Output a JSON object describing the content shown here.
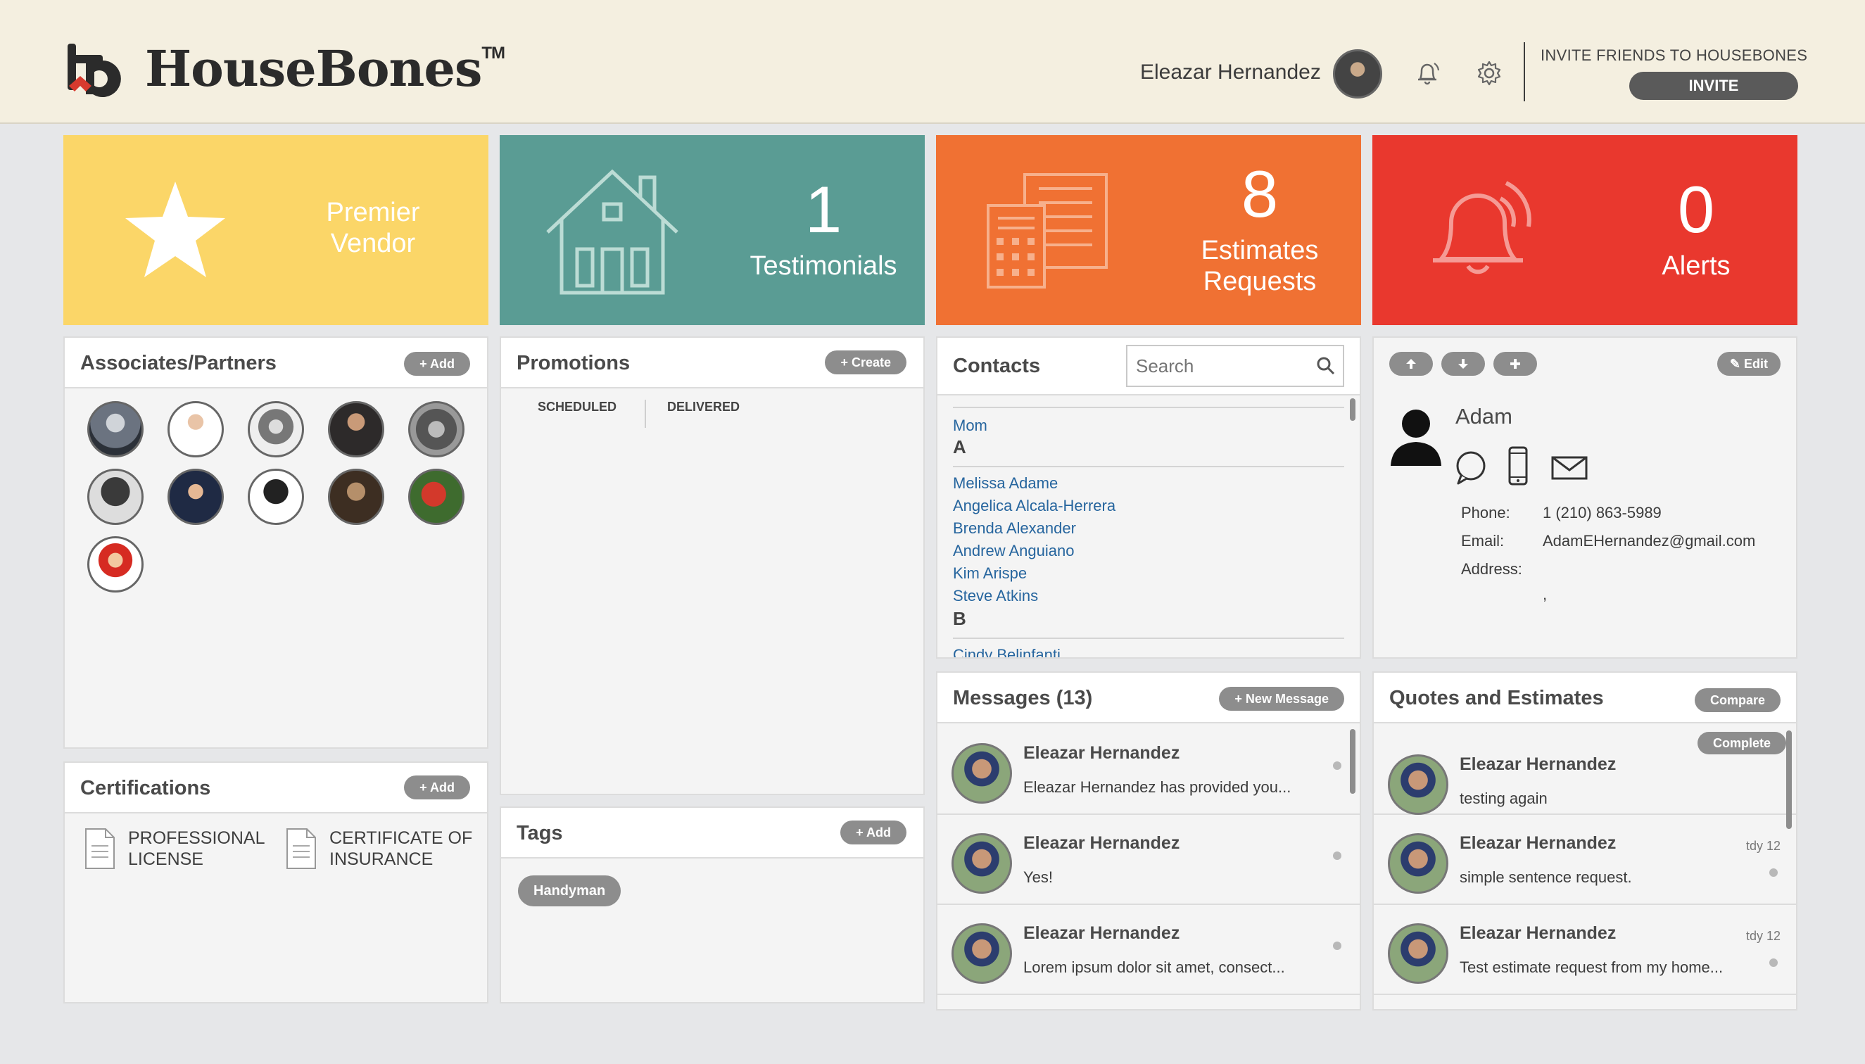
{
  "header": {
    "brand": "HouseBones",
    "brand_tm": "TM",
    "user_name": "Eleazar Hernandez",
    "invite_prompt": "INVITE FRIENDS TO HOUSEBONES",
    "invite_label": "INVITE"
  },
  "tiles": {
    "premier": {
      "label_line1": "Premier",
      "label_line2": "Vendor"
    },
    "testimonials": {
      "count": "1",
      "label": "Testimonials"
    },
    "estimates": {
      "count": "8",
      "label_line1": "Estimates",
      "label_line2": "Requests"
    },
    "alerts": {
      "count": "0",
      "label": "Alerts"
    }
  },
  "associates": {
    "title": "Associates/Partners",
    "add_label": "+ Add"
  },
  "certifications": {
    "title": "Certifications",
    "add_label": "+ Add",
    "items": [
      {
        "line1": "PROFESSIONAL",
        "line2": "LICENSE"
      },
      {
        "line1": "CERTIFICATE OF",
        "line2": "INSURANCE"
      }
    ]
  },
  "promotions": {
    "title": "Promotions",
    "create_label": "+ Create",
    "tab_scheduled": "SCHEDULED",
    "tab_delivered": "DELIVERED"
  },
  "tags": {
    "title": "Tags",
    "add_label": "+ Add",
    "items": [
      "Handyman"
    ]
  },
  "contacts": {
    "title": "Contacts",
    "search_placeholder": "Search",
    "top_link": "Mom",
    "group_a": "A",
    "a_items": [
      "Melissa Adame",
      "Angelica Alcala-Herrera",
      "Brenda Alexander",
      "Andrew Anguiano",
      "Kim Arispe",
      "Steve Atkins"
    ],
    "group_b": "B",
    "b_items": [
      "Cindy Belinfanti"
    ]
  },
  "contact_detail": {
    "edit_label": "✎ Edit",
    "name": "Adam",
    "phone_label": "Phone:",
    "phone": "1 (210) 863-5989",
    "email_label": "Email:",
    "email": "AdamEHernandez@gmail.com",
    "address_label": "Address:",
    "address": ","
  },
  "messages": {
    "title": "Messages (13)",
    "new_label": "+ New Message",
    "items": [
      {
        "name": "Eleazar Hernandez",
        "text": "Eleazar Hernandez has provided you..."
      },
      {
        "name": "Eleazar Hernandez",
        "text": "Yes!"
      },
      {
        "name": "Eleazar Hernandez",
        "text": "Lorem ipsum dolor sit amet, consect..."
      }
    ]
  },
  "quotes": {
    "title": "Quotes and Estimates",
    "compare_label": "Compare",
    "complete_label": "Complete",
    "items": [
      {
        "name": "Eleazar Hernandez",
        "text": "testing again",
        "date": ""
      },
      {
        "name": "Eleazar Hernandez",
        "text": "simple sentence request.",
        "date": "tdy 12"
      },
      {
        "name": "Eleazar Hernandez",
        "text": "Test estimate request from my home...",
        "date": "tdy 12"
      }
    ]
  }
}
